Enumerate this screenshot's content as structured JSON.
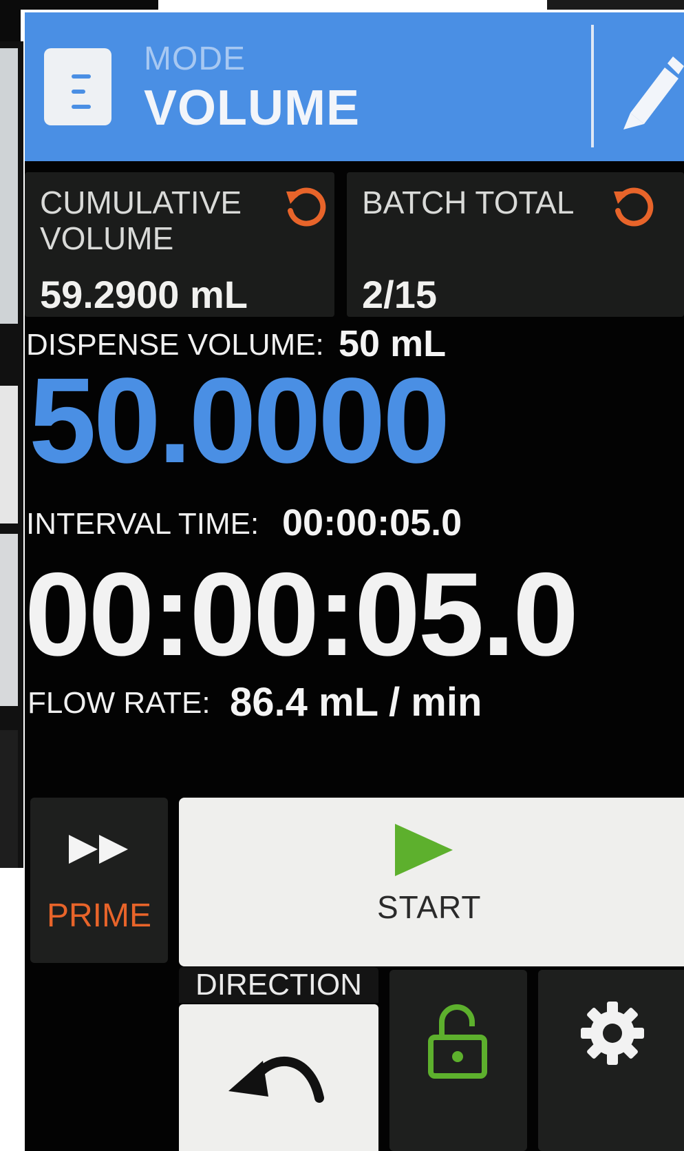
{
  "header": {
    "mode_label": "MODE",
    "mode_value": "VOLUME",
    "mode_icon": "beaker-icon",
    "edit_icon": "pencil-icon",
    "background_color": "#4a8fe4"
  },
  "tiles": {
    "cumulative": {
      "title_line1": "CUMULATIVE",
      "title_line2": "VOLUME",
      "value": "59.2900 mL",
      "reset_icon": "reset-icon"
    },
    "batch": {
      "title": "BATCH TOTAL",
      "value": "2/15",
      "reset_icon": "reset-icon"
    },
    "reset_color": "#e8642a"
  },
  "dispense": {
    "label": "DISPENSE VOLUME:",
    "setpoint": "50 mL",
    "current": "50.0000",
    "color": "#4a8fe4"
  },
  "interval": {
    "label": "INTERVAL TIME:",
    "setpoint": "00:00:05.0",
    "current": "00:00:05.0"
  },
  "flow": {
    "label": "FLOW RATE:",
    "value": "86.4 mL / min"
  },
  "controls": {
    "prime_label": "PRIME",
    "prime_icon": "fast-forward-icon",
    "prime_color": "#e8642a",
    "start_label": "START",
    "start_icon": "play-icon",
    "start_icon_color": "#5db02d",
    "direction_label": "DIRECTION",
    "direction_icon": "counterclockwise-arrow-icon",
    "lock_icon": "unlocked-padlock-icon",
    "lock_color": "#5db02d",
    "settings_icon": "gear-icon"
  }
}
